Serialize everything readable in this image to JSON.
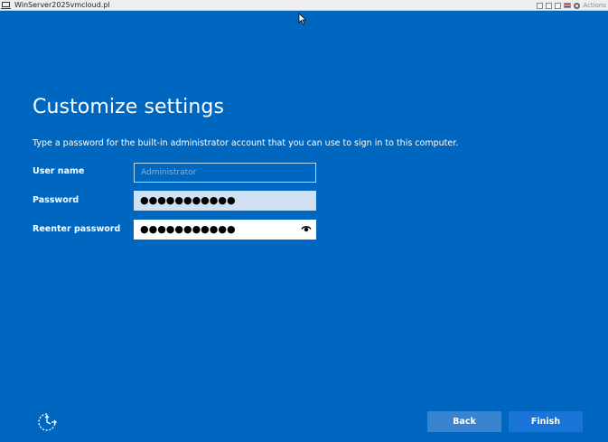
{
  "vm_window": {
    "title": "WinServer2025vmcloud.pl",
    "actions_label": "Actions"
  },
  "page": {
    "title": "Customize settings",
    "instructions": "Type a password for the built-in administrator account that you can use to sign in to this computer."
  },
  "form": {
    "username": {
      "label": "User name",
      "placeholder": "Administrator",
      "value": ""
    },
    "password": {
      "label": "Password",
      "value": "●●●●●●●●●●●"
    },
    "reenter_password": {
      "label": "Reenter password",
      "value": "●●●●●●●●●●●"
    }
  },
  "buttons": {
    "back": "Back",
    "finish": "Finish"
  },
  "icons": {
    "reveal": "eye-icon",
    "accessibility": "ease-of-access-icon"
  },
  "colors": {
    "background": "#0067c0",
    "button_back": "#3a84cf",
    "button_finish": "#1a73d6"
  }
}
